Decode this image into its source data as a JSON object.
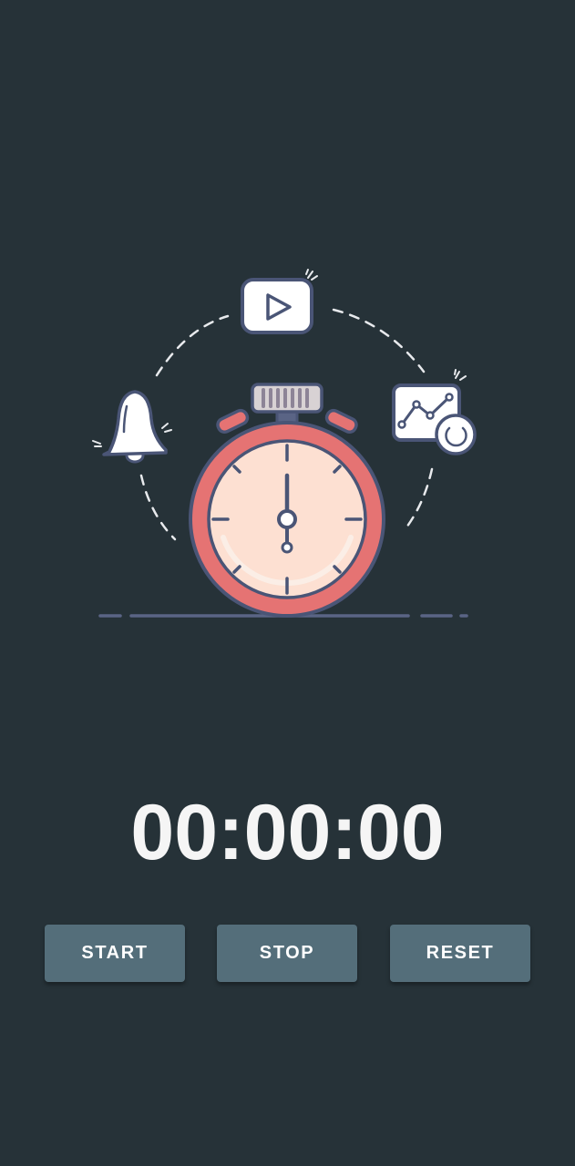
{
  "timer": {
    "display": "00:00:00"
  },
  "buttons": {
    "start_label": "START",
    "stop_label": "STOP",
    "reset_label": "RESET"
  },
  "colors": {
    "background": "#263238",
    "button": "#546e7a",
    "button_text": "#ffffff",
    "timer_text": "#f5f5f5",
    "stopwatch_body": "#e57373",
    "stopwatch_face": "#fde0d2",
    "outline": "#4a5576"
  },
  "illustration": {
    "icons": [
      "stopwatch-icon",
      "bell-icon",
      "play-icon",
      "chart-icon"
    ]
  }
}
